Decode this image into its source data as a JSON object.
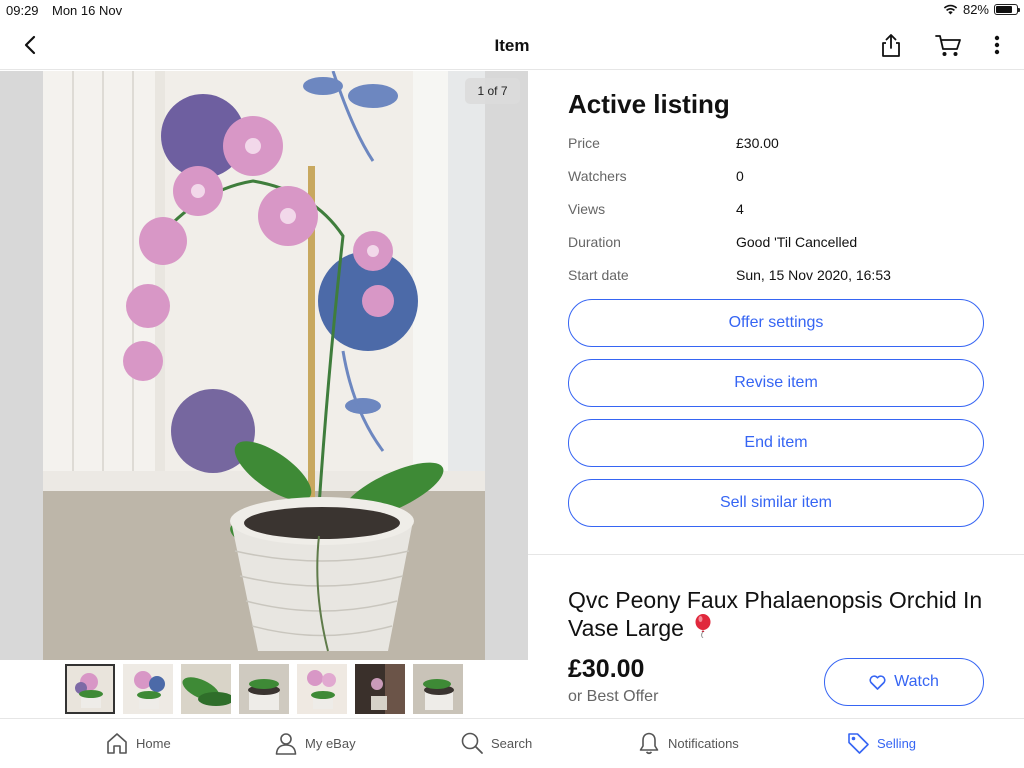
{
  "status": {
    "time": "09:29",
    "date": "Mon 16 Nov",
    "battery": "82%",
    "battery_level": 0.82
  },
  "nav": {
    "title": "Item",
    "icons": [
      "chevron-left-icon",
      "share-icon",
      "cart-icon",
      "more-icon"
    ]
  },
  "gallery": {
    "counter": "1 of 7",
    "thumbnail_count": 7,
    "selected_index": 0
  },
  "details": {
    "heading": "Active listing",
    "rows": [
      {
        "label": "Price",
        "value": "£30.00"
      },
      {
        "label": "Watchers",
        "value": "0"
      },
      {
        "label": "Views",
        "value": "4"
      },
      {
        "label": "Duration",
        "value": "Good 'Til Cancelled"
      },
      {
        "label": "Start date",
        "value": "Sun, 15 Nov 2020, 16:53"
      }
    ],
    "actions": [
      "Offer settings",
      "Revise item",
      "End item",
      "Sell similar item"
    ]
  },
  "item": {
    "title": "Qvc Peony Faux Phalaenopsis Orchid In Vase Large",
    "price": "£30.00",
    "offer_text": "or Best Offer",
    "watch_label": "Watch"
  },
  "tabs": [
    {
      "label": "Home",
      "icon": "home-icon"
    },
    {
      "label": "My eBay",
      "icon": "person-icon"
    },
    {
      "label": "Search",
      "icon": "search-icon"
    },
    {
      "label": "Notifications",
      "icon": "bell-icon"
    },
    {
      "label": "Selling",
      "icon": "tag-icon",
      "active": true
    }
  ],
  "colors": {
    "accent": "#3665f3",
    "balloon": "#e0283c"
  }
}
